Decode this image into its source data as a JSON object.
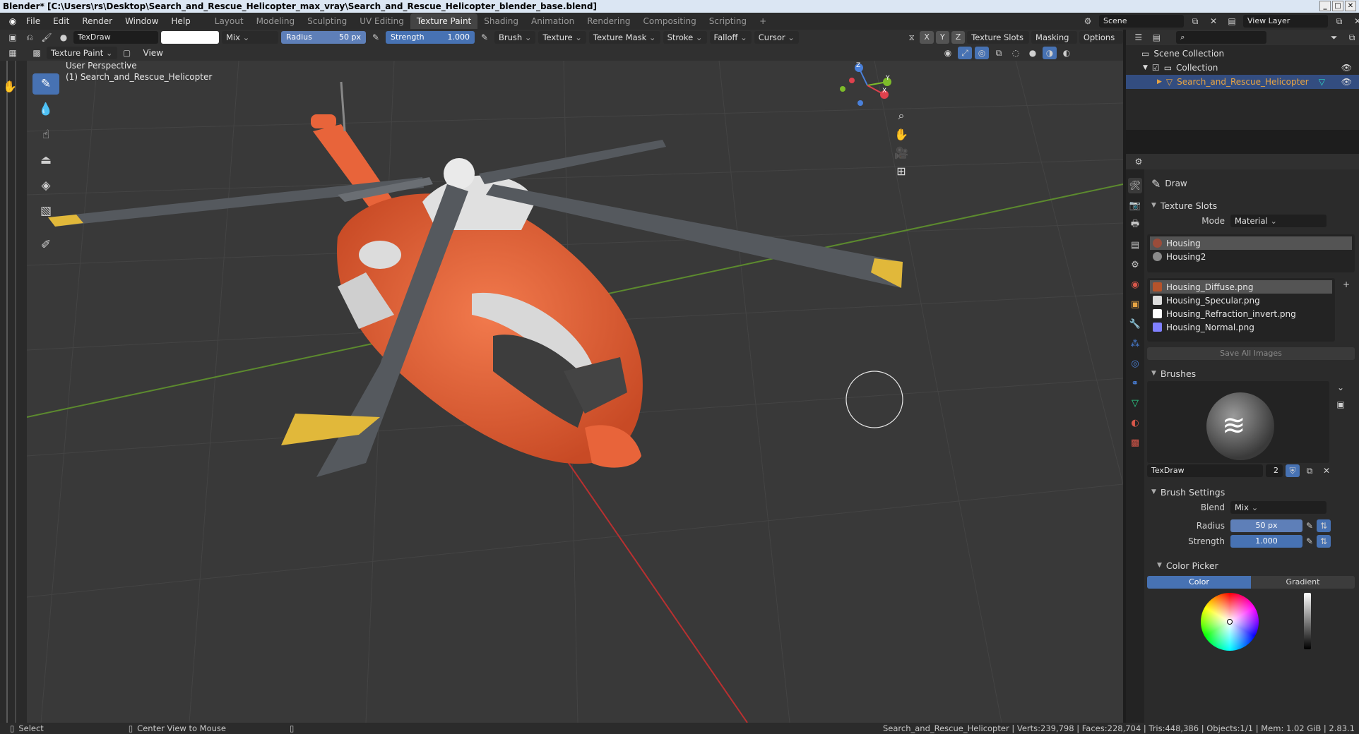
{
  "window": {
    "title": "Blender* [C:\\Users\\rs\\Desktop\\Search_and_Rescue_Helicopter_max_vray\\Search_and_Rescue_Helicopter_blender_base.blend]"
  },
  "menu": [
    "File",
    "Edit",
    "Render",
    "Window",
    "Help"
  ],
  "workspaces": [
    "Layout",
    "Modeling",
    "Sculpting",
    "UV Editing",
    "Texture Paint",
    "Shading",
    "Animation",
    "Rendering",
    "Compositing",
    "Scripting"
  ],
  "active_workspace": "Texture Paint",
  "scene": {
    "name": "Scene",
    "view_layer": "View Layer"
  },
  "tool_header": {
    "brush_name": "TexDraw",
    "blend": "Mix",
    "radius_label": "Radius",
    "radius_value": "50 px",
    "strength_label": "Strength",
    "strength_value": "1.000",
    "menus": [
      "Brush",
      "Texture",
      "Texture Mask",
      "Stroke",
      "Falloff",
      "Cursor"
    ],
    "axes": [
      "X",
      "Y",
      "Z"
    ],
    "right_menus": [
      "Texture Slots",
      "Masking",
      "Options"
    ]
  },
  "view_header": {
    "mode": "Texture Paint",
    "view": "View"
  },
  "viewport": {
    "perspective_label": "User Perspective",
    "object_label": "(1) Search_and_Rescue_Helicopter",
    "gizmo": {
      "x": "X",
      "y": "Y",
      "z": "Z"
    }
  },
  "outliner": {
    "items": [
      {
        "label": "Scene Collection"
      },
      {
        "label": "Collection"
      },
      {
        "label": "Search_and_Rescue_Helicopter"
      }
    ]
  },
  "properties": {
    "tool_name": "Draw",
    "texture_slots_title": "Texture Slots",
    "mode_label": "Mode",
    "mode_value": "Material",
    "materials": [
      "Housing",
      "Housing2"
    ],
    "images": [
      {
        "name": "Housing_Diffuse.png",
        "color": "#b5532b"
      },
      {
        "name": "Housing_Specular.png",
        "color": "#dddddd"
      },
      {
        "name": "Housing_Refraction_invert.png",
        "color": "#ffffff"
      },
      {
        "name": "Housing_Normal.png",
        "color": "#8080ff"
      }
    ],
    "save_all": "Save All Images",
    "brushes_title": "Brushes",
    "brush_name": "TexDraw",
    "brush_users": "2",
    "brush_settings_title": "Brush Settings",
    "blend_label": "Blend",
    "blend_value": "Mix",
    "radius_label": "Radius",
    "radius_value": "50 px",
    "strength_label": "Strength",
    "strength_value": "1.000",
    "color_picker_title": "Color Picker",
    "color_tab": "Color",
    "gradient_tab": "Gradient"
  },
  "statusbar": {
    "select": "Select",
    "center": "Center View to Mouse",
    "stats": "Search_and_Rescue_Helicopter | Verts:239,798 | Faces:228,704 | Tris:448,386 | Objects:1/1 | Mem: 1.02 GiB | 2.83.1"
  },
  "colors": {
    "accent": "#4772b3",
    "helicopter_body": "#e8643a",
    "rotor": "#55595e",
    "rotor_tip": "#e1b83a",
    "selection_text": "#e7a443"
  }
}
